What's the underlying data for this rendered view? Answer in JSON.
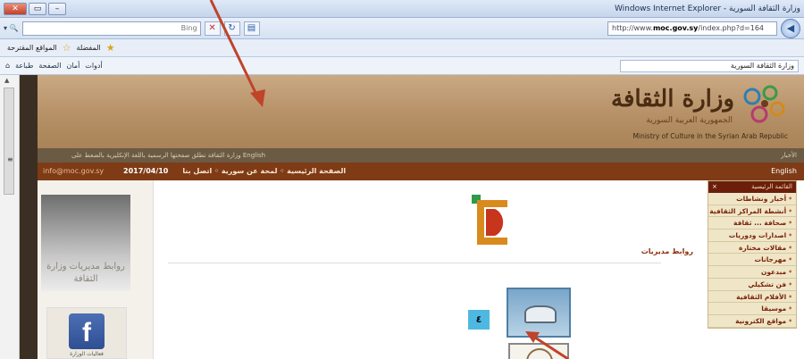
{
  "browser": {
    "window_title": "وزارة الثقافة السورية - Windows Internet Explorer",
    "search_placeholder": "Bing",
    "address": {
      "prefix": "http://www.",
      "domain": "moc.gov.sy",
      "suffix": "/index.php?d=164"
    },
    "favorites_label": "المفضلة",
    "suggested_sites": "المواقع المقترحة",
    "command_tools": [
      "أدوات",
      "أمان",
      "الصفحة",
      "طباعة"
    ],
    "tab_title": "وزارة الثقافة السورية"
  },
  "site": {
    "logo_title": "وزارة الثقافة",
    "logo_subtitle": "الجمهورية العربية السورية",
    "logo_english": "Ministry of Culture in the Syrian Arab Republic",
    "news_label": "الأخبار",
    "news_ticker": "وزارة الثقافة تطلق صفحتها الرسمية باللغة الإنكليزية بالضغط على English",
    "email": "info@moc.gov.sy",
    "top_links": "الصفحة الرئيسية  ◦  لمحة عن سورية  ◦  اتصل بنا",
    "date": "2017/04/10",
    "lang_switch": "English",
    "promo_text": "روابط مديريات وزارة الثقافة",
    "facebook_caption": "فعاليات الوزارة",
    "directorates_title": "روابط مديريات",
    "badge": "٤",
    "side_menu_title": "القائمة الرئيسية",
    "side_menu_items": [
      "أخبار ونشاطات",
      "أنشطة المراكز الثقافية",
      "صحافة ... ثقافة",
      "اصدارات ودوريات",
      "مقالات مختارة",
      "مهرجانات",
      "مبدعون",
      "فن تشكيلي",
      "الأفلام الثقافية",
      "موسيقا",
      "مواقع الكترونية"
    ]
  },
  "colors": {
    "banner": "#b48e64",
    "menubar": "#7e3b16",
    "side_menu_bg": "#efe6c8",
    "annotation_arrow": "#c0432a"
  }
}
